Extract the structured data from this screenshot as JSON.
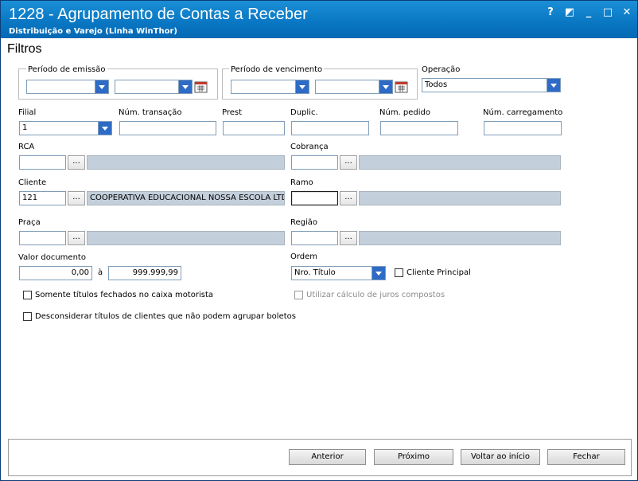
{
  "window": {
    "title": "1228 - Agrupamento de Contas a Receber",
    "subtitle": "Distribuição e Varejo (Linha WinThor)",
    "controls": [
      "?",
      "◩",
      "_",
      "□",
      "✕"
    ]
  },
  "section_title": "Filtros",
  "periodo_emissao": {
    "label": "Período de emissão",
    "from": "",
    "to": ""
  },
  "periodo_vencimento": {
    "label": "Período de vencimento",
    "from": "",
    "to": ""
  },
  "operacao": {
    "label": "Operação",
    "value": "Todos"
  },
  "filial": {
    "label": "Filial",
    "value": "1"
  },
  "num_transacao": {
    "label": "Núm. transação",
    "value": ""
  },
  "prest": {
    "label": "Prest",
    "value": ""
  },
  "duplic": {
    "label": "Duplic.",
    "value": ""
  },
  "num_pedido": {
    "label": "Núm. pedido",
    "value": ""
  },
  "num_carregamento": {
    "label": "Núm. carregamento",
    "value": ""
  },
  "rca": {
    "label": "RCA",
    "code": "",
    "button": "...",
    "description": ""
  },
  "cobranca": {
    "label": "Cobrança",
    "code": "",
    "button": "...",
    "description": ""
  },
  "cliente": {
    "label": "Cliente",
    "code": "121",
    "button": "...",
    "description": "COOPERATIVA EDUCACIONAL NOSSA ESCOLA LTDA"
  },
  "ramo": {
    "label": "Ramo",
    "code": "",
    "button": "...",
    "description": ""
  },
  "praca": {
    "label": "Praça",
    "code": "",
    "button": "...",
    "description": ""
  },
  "regiao": {
    "label": "Região",
    "code": "",
    "button": "...",
    "description": ""
  },
  "valor_documento": {
    "label": "Valor documento",
    "from": "0,00",
    "sep": "à",
    "to": "999.999,99"
  },
  "ordem": {
    "label": "Ordem",
    "value": "Nro. Título"
  },
  "checkboxes": {
    "cliente_principal": "Cliente Principal",
    "somente_fechados": "Somente títulos fechados no caixa motorista",
    "juros_compostos": "Utilizar cálculo de juros compostos",
    "desconsiderar": "Desconsiderar títulos de clientes que não podem agrupar boletos"
  },
  "buttons": {
    "anterior": "Anterior",
    "proximo": "Próximo",
    "voltar": "Voltar ao início",
    "fechar": "Fechar"
  },
  "colors": {
    "title_bar": "#0a78c4",
    "desc_field": "#c4cfdc",
    "combo_arrow": "#2e6bc6"
  }
}
